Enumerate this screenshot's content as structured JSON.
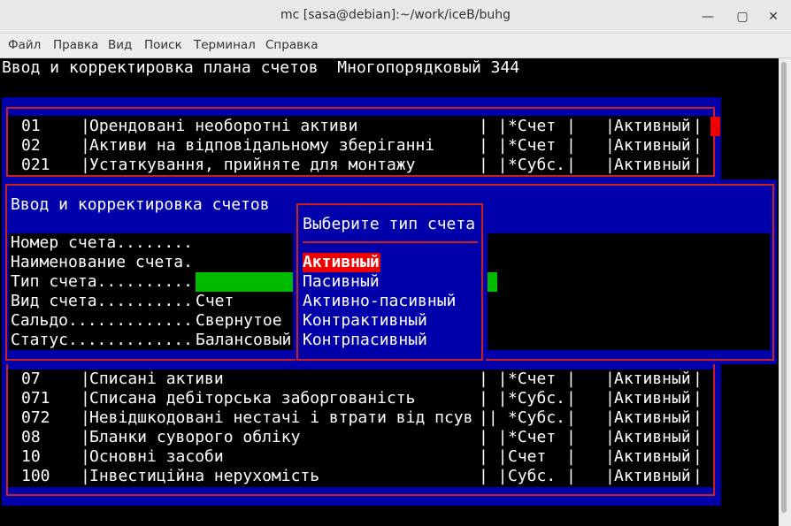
{
  "window": {
    "title": "mc [sasa@debian]:~/work/iceB/buhg",
    "minimize_glyph": "—",
    "maximize_glyph": "▢",
    "close_glyph": "✕"
  },
  "menu": [
    "Файл",
    "Правка",
    "Вид",
    "Поиск",
    "Терминал",
    "Справка"
  ],
  "header": "Ввод и корректировка плана счетов  Многопорядковый 344",
  "accounts_top": [
    {
      "code": "01",
      "name": "Орендовані необоротні активи",
      "kind": "*Счет ",
      "type": "Активный"
    },
    {
      "code": "02",
      "name": "Активи на відповідальному зберіганні",
      "kind": "*Счет ",
      "type": "Активный"
    },
    {
      "code": "021",
      "name": "Устаткування, прийняте для монтажу",
      "kind": "*Субс.",
      "type": "Активный"
    }
  ],
  "accounts_bottom": [
    {
      "code": "07",
      "name": "Списані активи",
      "kind": "*Счет ",
      "type": "Активный"
    },
    {
      "code": "071",
      "name": "Списана дебіторська заборгованість",
      "kind": "*Субс.",
      "type": "Активный"
    },
    {
      "code": "072",
      "name": "Невідшкодовані нестачі і втрати від псув",
      "kind": "*Субс.",
      "type": "Активный"
    },
    {
      "code": "08",
      "name": "Бланки суворого обліку",
      "kind": "*Счет ",
      "type": "Активный"
    },
    {
      "code": "10",
      "name": "Основні засоби",
      "kind": "Счет  ",
      "type": "Активный"
    },
    {
      "code": "100",
      "name": "Інвестиційна нерухомість",
      "kind": "Субс. ",
      "type": "Активный"
    }
  ],
  "edit_form": {
    "title": "Ввод и корректировка счетов",
    "fields": [
      {
        "label": "Номер счета........",
        "value": ""
      },
      {
        "label": "Наименование счета.",
        "value": ""
      },
      {
        "label": "Тип счета..........",
        "value": ""
      },
      {
        "label": "Вид счета..........",
        "value": "Счет"
      },
      {
        "label": "Сальдо.............",
        "value": "Свернутое"
      },
      {
        "label": "Статус.............",
        "value": "Балансовый"
      }
    ]
  },
  "type_menu": {
    "title": "Выберите тип счета",
    "selected": "Активный",
    "options": [
      "Активный",
      "Пасивный",
      "Активно-пасивный",
      "Контрактивный",
      "Контрпасивный"
    ]
  }
}
